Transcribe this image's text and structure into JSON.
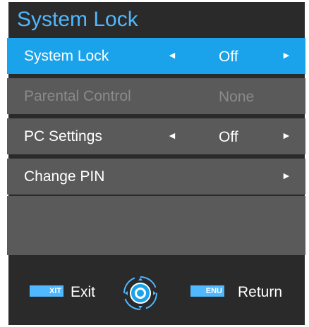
{
  "title": "System Lock",
  "menu": [
    {
      "label": "System Lock",
      "value": "Off",
      "has_left": true,
      "has_right": true,
      "state": "selected"
    },
    {
      "label": "Parental Control",
      "value": "None",
      "has_left": false,
      "has_right": false,
      "state": "disabled"
    },
    {
      "label": "PC Settings",
      "value": "Off",
      "has_left": true,
      "has_right": true,
      "state": "normal"
    },
    {
      "label": "Change PIN",
      "value": "",
      "has_left": false,
      "has_right": true,
      "state": "normal"
    }
  ],
  "arrows": {
    "left": "◄",
    "right": "►"
  },
  "footer": {
    "exit_key": "XIT",
    "exit_label": "Exit",
    "menu_key": "ENU",
    "return_label": "Return"
  },
  "icons": [
    "left-arrow-icon",
    "right-arrow-icon",
    "joystick-icon"
  ],
  "colors": {
    "accent": "#1aa3ea",
    "title": "#4fb8ff",
    "panel": "#5a5a5a",
    "bg": "#2a2a2a"
  }
}
